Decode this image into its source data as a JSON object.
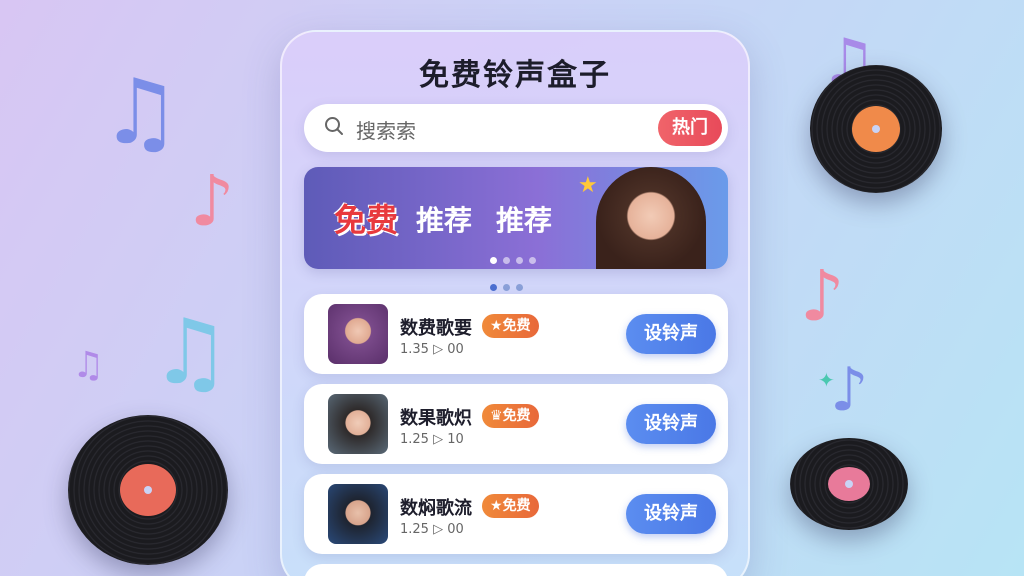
{
  "app": {
    "title": "免费铃声盒子"
  },
  "search": {
    "placeholder": "搜索索",
    "hot_label": "热门"
  },
  "banner": {
    "word1": "免费",
    "word2": "推荐",
    "word3": "推荐",
    "dots": 4,
    "active_dot": 0
  },
  "pager": {
    "dots": 3,
    "active": 0
  },
  "songs": [
    {
      "name": "数费歌要",
      "badge": "免费",
      "meta": "1.35 ▷ 00",
      "button": "设铃声",
      "avatar_color": "#7a4a8a"
    },
    {
      "name": "数果歌炽",
      "badge": "免费",
      "meta": "1.25 ▷ 10",
      "button": "设铃声",
      "avatar_color": "#4a5a6a"
    },
    {
      "name": "数焖歌流",
      "badge": "免费",
      "meta": "1.25 ▷ 00",
      "button": "设铃声",
      "avatar_color": "#2a4a7a"
    }
  ],
  "colors": {
    "accent": "#4a78e6",
    "hot": "#e84a5a",
    "badge": "#e8683a"
  },
  "icons": {
    "search": "search-icon",
    "badge_crown": "crown-icon"
  }
}
